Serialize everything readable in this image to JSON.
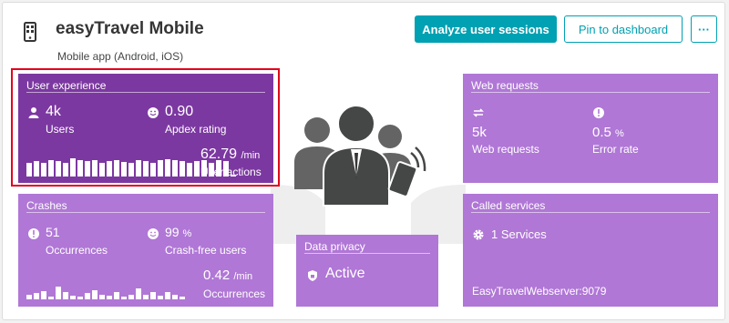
{
  "header": {
    "title": "easyTravel Mobile",
    "subtitle": "Mobile app (Android, iOS)",
    "analyze_label": "Analyze user sessions",
    "pin_label": "Pin to dashboard",
    "more_label": "···"
  },
  "user_experience": {
    "title": "User experience",
    "users_value": "4k",
    "users_label": "Users",
    "apdex_value": "0.90",
    "apdex_label": "Apdex rating",
    "actions_value": "62.79",
    "actions_unit": "/min",
    "actions_label": "User actions",
    "sparkline": [
      0.7,
      0.75,
      0.7,
      0.8,
      0.75,
      0.7,
      0.9,
      0.8,
      0.75,
      0.8,
      0.7,
      0.75,
      0.8,
      0.72,
      0.7,
      0.8,
      0.75,
      0.7,
      0.8,
      0.85,
      0.8,
      0.75,
      0.7,
      0.75,
      0.8,
      0.7,
      0.8,
      0.75,
      0.05
    ]
  },
  "crashes": {
    "title": "Crashes",
    "occ_value": "51",
    "occ_label": "Occurrences",
    "free_value": "99",
    "free_unit": "%",
    "free_label": "Crash-free users",
    "rate_value": "0.42",
    "rate_unit": "/min",
    "rate_label": "Occurrences",
    "sparkline": [
      0.2,
      0.25,
      0.35,
      0.1,
      0.55,
      0.3,
      0.15,
      0.1,
      0.25,
      0.4,
      0.2,
      0.15,
      0.3,
      0.1,
      0.2,
      0.45,
      0.2,
      0.3,
      0.15,
      0.3,
      0.2,
      0.1
    ]
  },
  "web_requests": {
    "title": "Web requests",
    "req_value": "5k",
    "req_label": "Web requests",
    "err_value": "0.5",
    "err_unit": "%",
    "err_label": "Error rate"
  },
  "privacy": {
    "title": "Data privacy",
    "status": "Active"
  },
  "called_services": {
    "title": "Called services",
    "count_label": "1 Services",
    "server": "EasyTravelWebserver:9079"
  },
  "colors": {
    "accent": "#00a1b2",
    "tile_dark": "#7c38a1",
    "tile_light": "#b077d6",
    "highlight": "#e2001a"
  },
  "icons": [
    "mobile-app-icon",
    "user-icon",
    "smiley-icon",
    "exclamation-icon",
    "arrows-icon",
    "gear-icon",
    "shield-icon",
    "users-group-icon"
  ]
}
